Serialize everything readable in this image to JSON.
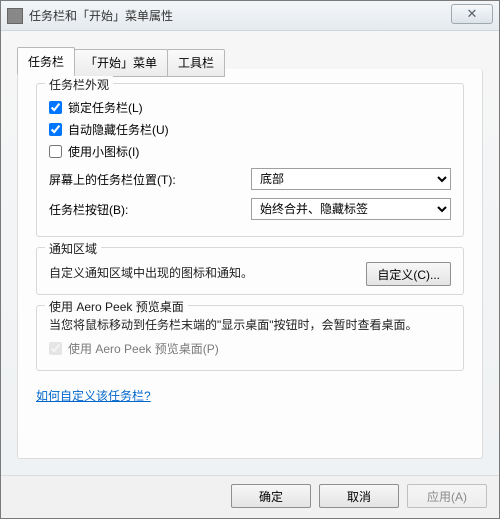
{
  "window": {
    "title": "任务栏和「开始」菜单属性",
    "close_glyph": "✕"
  },
  "tabs": {
    "taskbar": "任务栏",
    "startmenu": "「开始」菜单",
    "toolbar": "工具栏"
  },
  "appearance": {
    "title": "任务栏外观",
    "lock_label": "锁定任务栏(L)",
    "lock_checked": true,
    "autohide_label": "自动隐藏任务栏(U)",
    "autohide_checked": true,
    "smallicons_label": "使用小图标(I)",
    "smallicons_checked": false,
    "position_label": "屏幕上的任务栏位置(T):",
    "position_value": "底部",
    "buttons_label": "任务栏按钮(B):",
    "buttons_value": "始终合并、隐藏标签"
  },
  "notification": {
    "title": "通知区域",
    "desc": "自定义通知区域中出现的图标和通知。",
    "customize_label": "自定义(C)..."
  },
  "aeropeek": {
    "title": "使用 Aero Peek 预览桌面",
    "desc": "当您将鼠标移动到任务栏末端的\"显示桌面\"按钮时，会暂时查看桌面。",
    "check_label": "使用 Aero Peek 预览桌面(P)",
    "check_checked": true
  },
  "link": "如何自定义该任务栏?",
  "buttons": {
    "ok": "确定",
    "cancel": "取消",
    "apply": "应用(A)"
  }
}
